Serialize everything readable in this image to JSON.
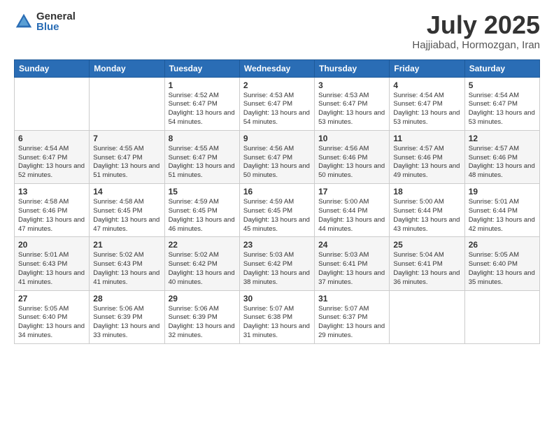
{
  "header": {
    "logo_general": "General",
    "logo_blue": "Blue",
    "month_year": "July 2025",
    "location": "Hajjiabad, Hormozgan, Iran"
  },
  "weekdays": [
    "Sunday",
    "Monday",
    "Tuesday",
    "Wednesday",
    "Thursday",
    "Friday",
    "Saturday"
  ],
  "weeks": [
    [
      {
        "day": "",
        "info": ""
      },
      {
        "day": "",
        "info": ""
      },
      {
        "day": "1",
        "info": "Sunrise: 4:52 AM\nSunset: 6:47 PM\nDaylight: 13 hours and 54 minutes."
      },
      {
        "day": "2",
        "info": "Sunrise: 4:53 AM\nSunset: 6:47 PM\nDaylight: 13 hours and 54 minutes."
      },
      {
        "day": "3",
        "info": "Sunrise: 4:53 AM\nSunset: 6:47 PM\nDaylight: 13 hours and 53 minutes."
      },
      {
        "day": "4",
        "info": "Sunrise: 4:54 AM\nSunset: 6:47 PM\nDaylight: 13 hours and 53 minutes."
      },
      {
        "day": "5",
        "info": "Sunrise: 4:54 AM\nSunset: 6:47 PM\nDaylight: 13 hours and 53 minutes."
      }
    ],
    [
      {
        "day": "6",
        "info": "Sunrise: 4:54 AM\nSunset: 6:47 PM\nDaylight: 13 hours and 52 minutes."
      },
      {
        "day": "7",
        "info": "Sunrise: 4:55 AM\nSunset: 6:47 PM\nDaylight: 13 hours and 51 minutes."
      },
      {
        "day": "8",
        "info": "Sunrise: 4:55 AM\nSunset: 6:47 PM\nDaylight: 13 hours and 51 minutes."
      },
      {
        "day": "9",
        "info": "Sunrise: 4:56 AM\nSunset: 6:47 PM\nDaylight: 13 hours and 50 minutes."
      },
      {
        "day": "10",
        "info": "Sunrise: 4:56 AM\nSunset: 6:46 PM\nDaylight: 13 hours and 50 minutes."
      },
      {
        "day": "11",
        "info": "Sunrise: 4:57 AM\nSunset: 6:46 PM\nDaylight: 13 hours and 49 minutes."
      },
      {
        "day": "12",
        "info": "Sunrise: 4:57 AM\nSunset: 6:46 PM\nDaylight: 13 hours and 48 minutes."
      }
    ],
    [
      {
        "day": "13",
        "info": "Sunrise: 4:58 AM\nSunset: 6:46 PM\nDaylight: 13 hours and 47 minutes."
      },
      {
        "day": "14",
        "info": "Sunrise: 4:58 AM\nSunset: 6:45 PM\nDaylight: 13 hours and 47 minutes."
      },
      {
        "day": "15",
        "info": "Sunrise: 4:59 AM\nSunset: 6:45 PM\nDaylight: 13 hours and 46 minutes."
      },
      {
        "day": "16",
        "info": "Sunrise: 4:59 AM\nSunset: 6:45 PM\nDaylight: 13 hours and 45 minutes."
      },
      {
        "day": "17",
        "info": "Sunrise: 5:00 AM\nSunset: 6:44 PM\nDaylight: 13 hours and 44 minutes."
      },
      {
        "day": "18",
        "info": "Sunrise: 5:00 AM\nSunset: 6:44 PM\nDaylight: 13 hours and 43 minutes."
      },
      {
        "day": "19",
        "info": "Sunrise: 5:01 AM\nSunset: 6:44 PM\nDaylight: 13 hours and 42 minutes."
      }
    ],
    [
      {
        "day": "20",
        "info": "Sunrise: 5:01 AM\nSunset: 6:43 PM\nDaylight: 13 hours and 41 minutes."
      },
      {
        "day": "21",
        "info": "Sunrise: 5:02 AM\nSunset: 6:43 PM\nDaylight: 13 hours and 41 minutes."
      },
      {
        "day": "22",
        "info": "Sunrise: 5:02 AM\nSunset: 6:42 PM\nDaylight: 13 hours and 40 minutes."
      },
      {
        "day": "23",
        "info": "Sunrise: 5:03 AM\nSunset: 6:42 PM\nDaylight: 13 hours and 38 minutes."
      },
      {
        "day": "24",
        "info": "Sunrise: 5:03 AM\nSunset: 6:41 PM\nDaylight: 13 hours and 37 minutes."
      },
      {
        "day": "25",
        "info": "Sunrise: 5:04 AM\nSunset: 6:41 PM\nDaylight: 13 hours and 36 minutes."
      },
      {
        "day": "26",
        "info": "Sunrise: 5:05 AM\nSunset: 6:40 PM\nDaylight: 13 hours and 35 minutes."
      }
    ],
    [
      {
        "day": "27",
        "info": "Sunrise: 5:05 AM\nSunset: 6:40 PM\nDaylight: 13 hours and 34 minutes."
      },
      {
        "day": "28",
        "info": "Sunrise: 5:06 AM\nSunset: 6:39 PM\nDaylight: 13 hours and 33 minutes."
      },
      {
        "day": "29",
        "info": "Sunrise: 5:06 AM\nSunset: 6:39 PM\nDaylight: 13 hours and 32 minutes."
      },
      {
        "day": "30",
        "info": "Sunrise: 5:07 AM\nSunset: 6:38 PM\nDaylight: 13 hours and 31 minutes."
      },
      {
        "day": "31",
        "info": "Sunrise: 5:07 AM\nSunset: 6:37 PM\nDaylight: 13 hours and 29 minutes."
      },
      {
        "day": "",
        "info": ""
      },
      {
        "day": "",
        "info": ""
      }
    ]
  ]
}
